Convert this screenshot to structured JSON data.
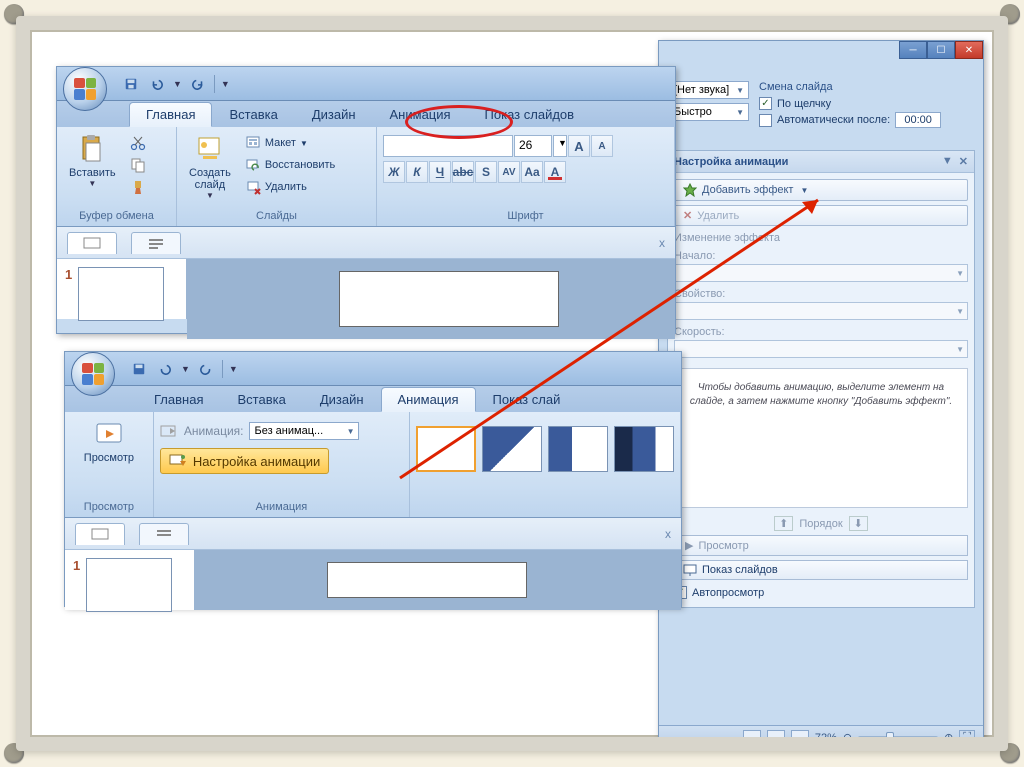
{
  "shot1": {
    "tabs": [
      "Главная",
      "Вставка",
      "Дизайн",
      "Анимация",
      "Показ слайдов"
    ],
    "active_tab_index": 0,
    "clipboard": {
      "paste": "Вставить",
      "label": "Буфер обмена"
    },
    "slides": {
      "new_slide": "Создать\nслайд",
      "layout": "Макет",
      "reset": "Восстановить",
      "delete": "Удалить",
      "label": "Слайды"
    },
    "font": {
      "size": "26",
      "label": "Шрифт"
    },
    "outline_tabs": {
      "close": "x"
    },
    "slide_number": "1"
  },
  "shot2": {
    "tabs": [
      "Главная",
      "Вставка",
      "Дизайн",
      "Анимация",
      "Показ слай"
    ],
    "active_tab_index": 3,
    "preview": {
      "btn": "Просмотр",
      "label": "Просмотр"
    },
    "animation": {
      "anim_label": "Анимация:",
      "anim_value": "Без анимац...",
      "custom": "Настройка анимации",
      "label": "Анимация"
    },
    "outline_tabs": {
      "close": "x"
    },
    "slide_number": "1"
  },
  "shot3": {
    "sound_label": "[Нет звука]",
    "speed_label": "Быстро",
    "advance_title": "Смена слайда",
    "on_click": "По щелчку",
    "auto_after": "Автоматически после:",
    "auto_time": "00:00",
    "taskpane": {
      "title": "Настройка анимации",
      "add_effect": "Добавить эффект",
      "remove": "Удалить",
      "modify": "Изменение эффекта",
      "start": "Начало:",
      "property": "Свойство:",
      "speed": "Скорость:",
      "hint": "Чтобы добавить анимацию, выделите элемент на слайде, а затем нажмите кнопку \"Добавить эффект\".",
      "order": "Порядок",
      "play": "Просмотр",
      "slideshow": "Показ слайдов",
      "autopreview": "Автопросмотр"
    },
    "status": {
      "zoom": "72%"
    }
  }
}
